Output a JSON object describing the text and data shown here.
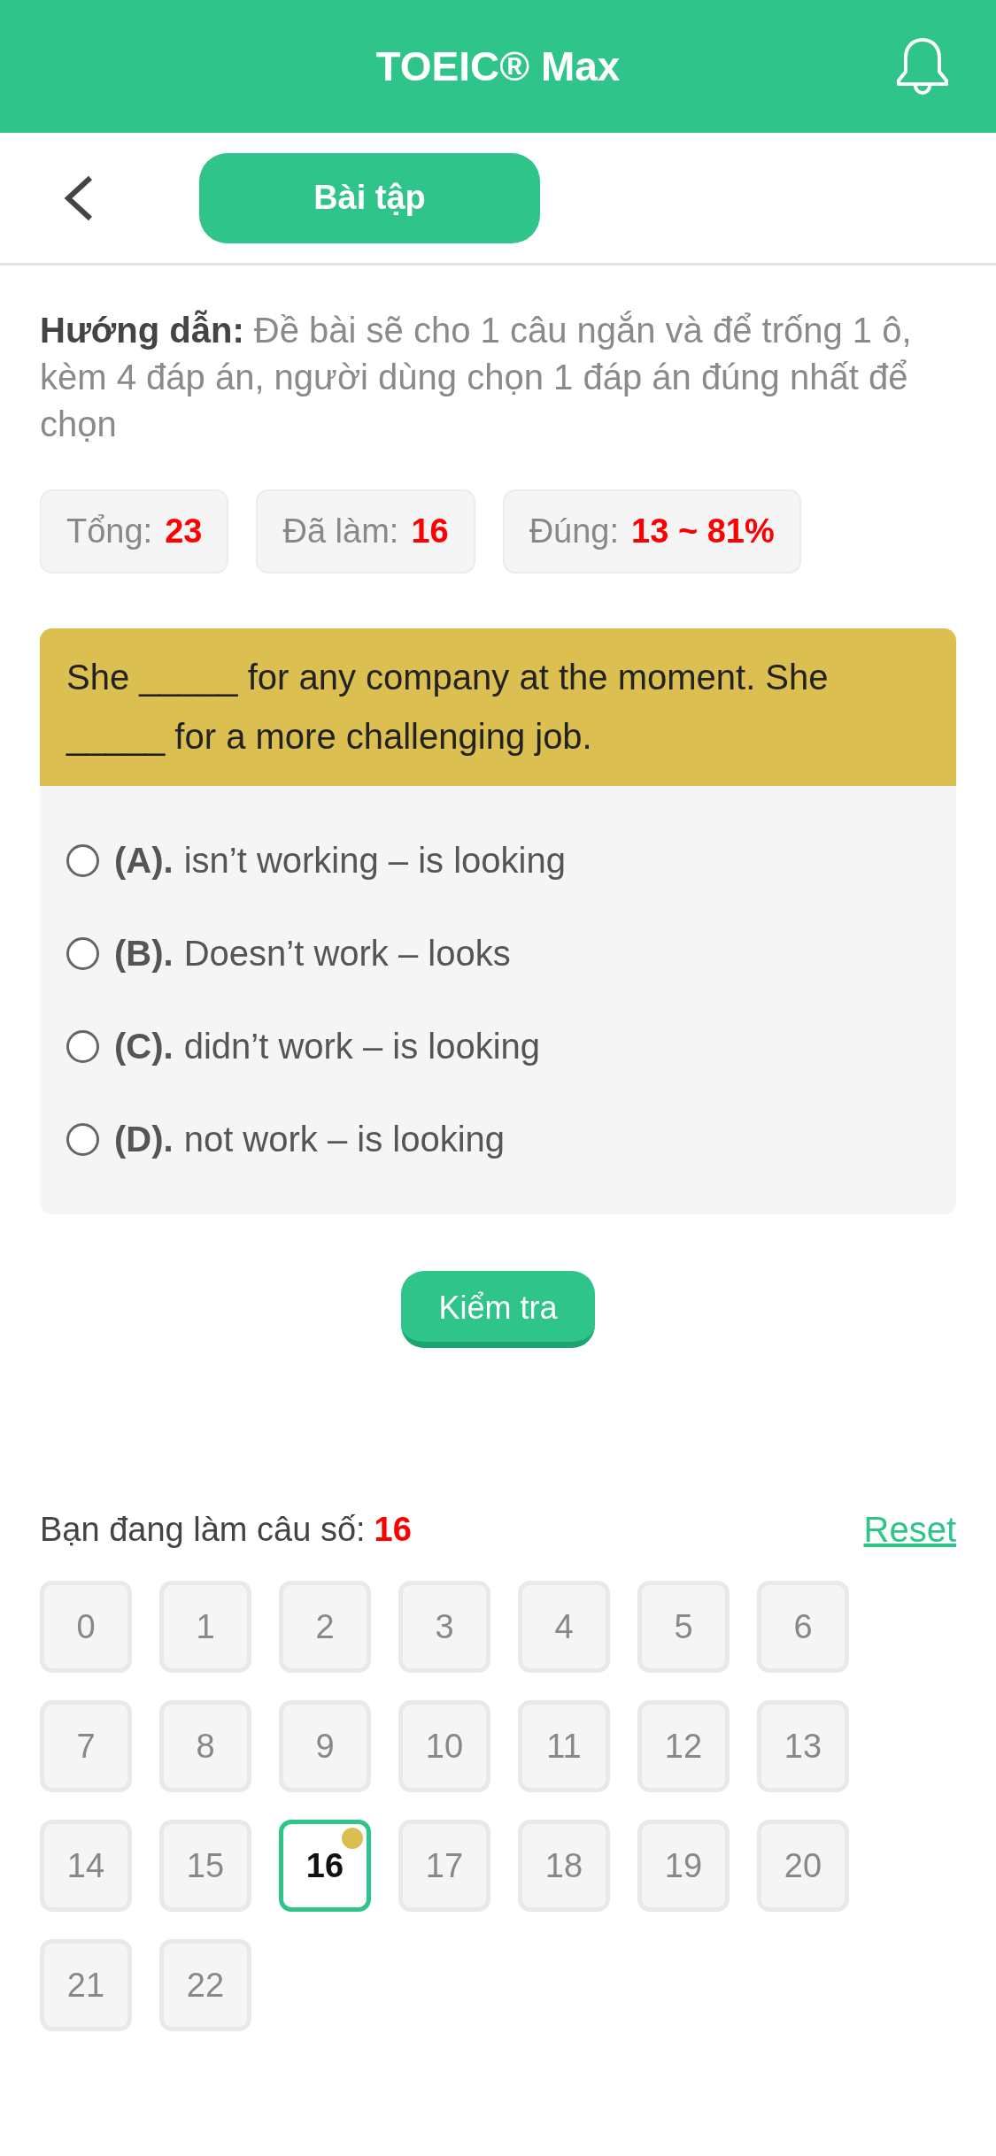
{
  "header": {
    "title": "TOEIC® Max"
  },
  "toolbar": {
    "button": "Bài tập"
  },
  "instructions": "**Hướng dẫn:** Đề bài sẽ cho 1 câu ngắn và để trống 1 ô, kèm 4 đáp án, người dùng chọn 1 đáp án đúng nhất để chọn",
  "stats": [
    {
      "label": "Tổng:",
      "value": "23"
    },
    {
      "label": "Đã làm:",
      "value": "16"
    },
    {
      "label": "Đúng:",
      "value": "13 ~ 81%"
    }
  ],
  "question": {
    "text": "She _____ for any company at the moment. She _____ for a more challenging job.",
    "options": [
      {
        "letter": "(A).",
        "text": "isn’t working – is looking",
        "selected": false
      },
      {
        "letter": "(B).",
        "text": "Doesn’t work – looks",
        "selected": false
      },
      {
        "letter": "(C).",
        "text": "didn’t work – is looking",
        "selected": false
      },
      {
        "letter": "(D).",
        "text": "not work – is looking",
        "selected": false
      }
    ]
  },
  "check_button": "Kiểm tra",
  "progress": {
    "label": "Bạn đang làm câu số:",
    "current": "16",
    "reset": "Reset"
  },
  "question_grid": [
    {
      "label": "0",
      "selected": false,
      "marked": false
    },
    {
      "label": "1",
      "selected": false,
      "marked": false
    },
    {
      "label": "2",
      "selected": false,
      "marked": false
    },
    {
      "label": "3",
      "selected": false,
      "marked": false
    },
    {
      "label": "4",
      "selected": false,
      "marked": false
    },
    {
      "label": "5",
      "selected": false,
      "marked": false
    },
    {
      "label": "6",
      "selected": false,
      "marked": false
    },
    {
      "label": "7",
      "selected": false,
      "marked": false
    },
    {
      "label": "8",
      "selected": false,
      "marked": false
    },
    {
      "label": "9",
      "selected": false,
      "marked": false
    },
    {
      "label": "10",
      "selected": false,
      "marked": false
    },
    {
      "label": "11",
      "selected": false,
      "marked": false
    },
    {
      "label": "12",
      "selected": false,
      "marked": false
    },
    {
      "label": "13",
      "selected": false,
      "marked": false
    },
    {
      "label": "14",
      "selected": false,
      "marked": false
    },
    {
      "label": "15",
      "selected": false,
      "marked": false
    },
    {
      "label": "16",
      "selected": true,
      "marked": true
    },
    {
      "label": "17",
      "selected": false,
      "marked": false
    },
    {
      "label": "18",
      "selected": false,
      "marked": false
    },
    {
      "label": "19",
      "selected": false,
      "marked": false
    },
    {
      "label": "20",
      "selected": false,
      "marked": false
    },
    {
      "label": "21",
      "selected": false,
      "marked": false
    },
    {
      "label": "22",
      "selected": false,
      "marked": false
    }
  ]
}
